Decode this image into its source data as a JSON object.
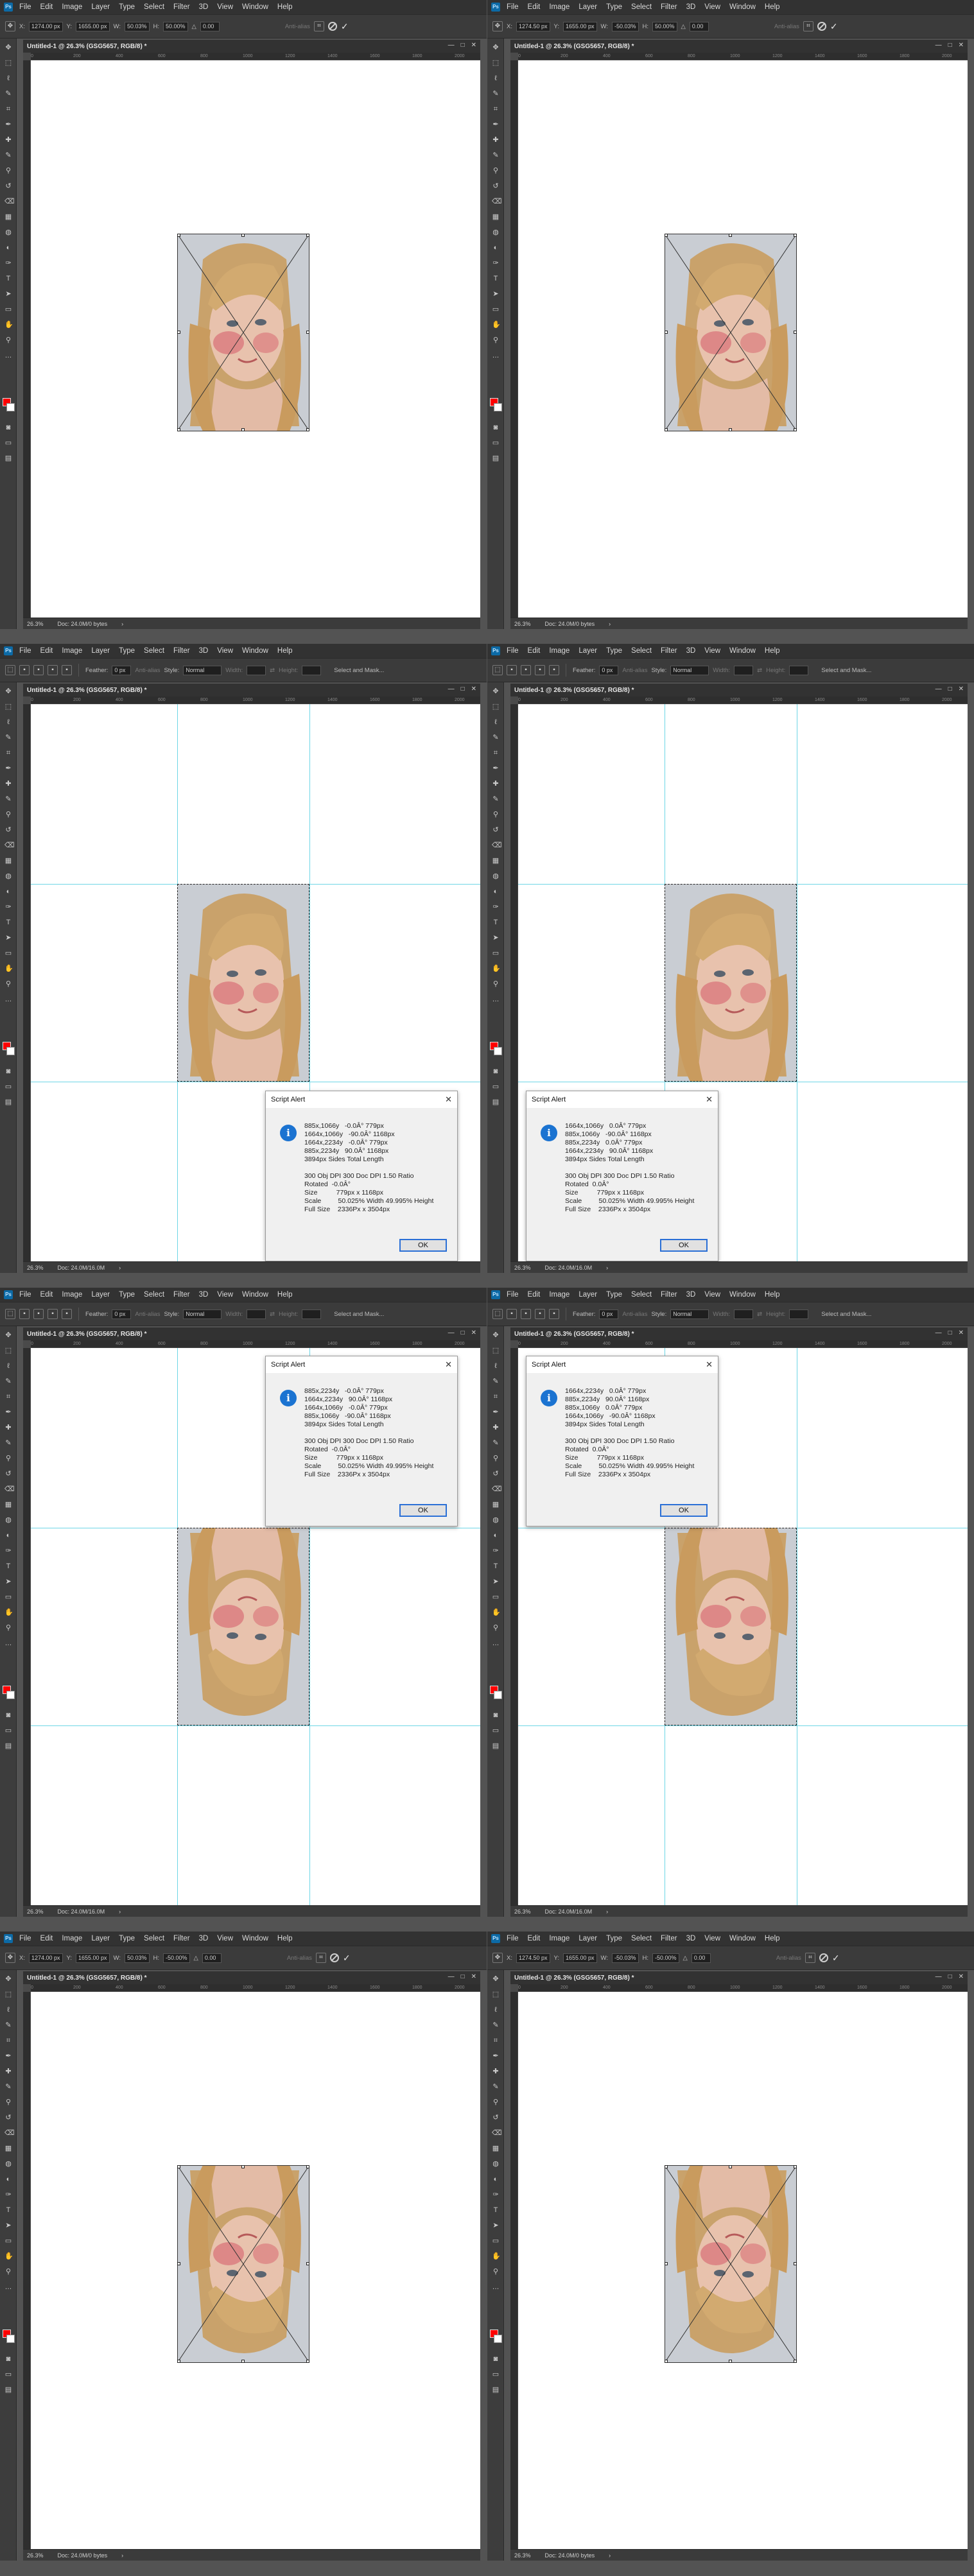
{
  "app": {
    "logo_text": "Ps",
    "menu": [
      "File",
      "Edit",
      "Image",
      "Layer",
      "Type",
      "Select",
      "Filter",
      "3D",
      "View",
      "Window",
      "Help"
    ],
    "doc_title": "Untitled-1 @ 26.3% (GSG5657, RGB/8) *",
    "zoom": "26.3%",
    "window_controls": [
      "—",
      "□",
      "✕"
    ],
    "ruler_ticks": [
      "0",
      "200",
      "400",
      "600",
      "800",
      "1000",
      "1200",
      "1400",
      "1600",
      "1800",
      "2000"
    ]
  },
  "transform_bar": {
    "x_label": "X:",
    "y_label": "Y:",
    "w_label": "W:",
    "h_label": "H:",
    "angle_label": "△",
    "interp_label": "Anti-alias"
  },
  "marquee_bar": {
    "feather_label": "Feather:",
    "feather_value": "0 px",
    "antialias_label": "Anti-alias",
    "style_label": "Style:",
    "style_value": "Normal",
    "width_label": "Width:",
    "height_label": "Height:",
    "select_mask_label": "Select and Mask..."
  },
  "panes": [
    {
      "mode": "transform",
      "opts": {
        "x": "1274.00 px",
        "y": "1655.00 px",
        "w": "50.03%",
        "h": "50.00%",
        "angle": "0.00"
      },
      "doc_status": "Doc: 24.0M/0 bytes",
      "photo_flipped": false
    },
    {
      "mode": "transform",
      "opts": {
        "x": "1274.50 px",
        "y": "1655.00 px",
        "w": "-50.03%",
        "h": "50.00%",
        "angle": "0.00"
      },
      "doc_status": "Doc: 24.0M/0 bytes",
      "photo_flipped": false
    },
    {
      "mode": "alert",
      "doc_status": "Doc: 24.0M/16.0M",
      "photo_flipped": false,
      "dialog": {
        "title": "Script Alert",
        "lines1": [
          "885x,1066y   -0.0Â° 779px",
          "1664x,1066y   -90.0Â° 1168px",
          "1664x,2234y   -0.0Â° 779px",
          "885x,2234y   90.0Â° 1168px",
          "3894px Sides Total Length"
        ],
        "lines2": [
          "300 Obj DPI 300 Doc DPI 1.50 Ratio",
          "Rotated  -0.0Â°",
          "Size          779px x 1168px",
          "Scale         50.025% Width 49.995% Height",
          "Full Size    2336Px x 3504px"
        ],
        "ok": "OK"
      }
    },
    {
      "mode": "alert",
      "doc_status": "Doc: 24.0M/16.0M",
      "photo_flipped": false,
      "dialog": {
        "title": "Script Alert",
        "lines1": [
          "1664x,1066y   0.0Â° 779px",
          "885x,1066y   -90.0Â° 1168px",
          "885x,2234y   0.0Â° 779px",
          "1664x,2234y   90.0Â° 1168px",
          "3894px Sides Total Length"
        ],
        "lines2": [
          "300 Obj DPI 300 Doc DPI 1.50 Ratio",
          "Rotated  0.0Â°",
          "Size          779px x 1168px",
          "Scale         50.025% Width 49.995% Height",
          "Full Size    2336Px x 3504px"
        ],
        "ok": "OK"
      }
    },
    {
      "mode": "alert",
      "doc_status": "Doc: 24.0M/16.0M",
      "photo_flipped": true,
      "dialog": {
        "title": "Script Alert",
        "lines1": [
          "885x,2234y   -0.0Â° 779px",
          "1664x,2234y   90.0Â° 1168px",
          "1664x,1066y   -0.0Â° 779px",
          "885x,1066y   -90.0Â° 1168px",
          "3894px Sides Total Length"
        ],
        "lines2": [
          "300 Obj DPI 300 Doc DPI 1.50 Ratio",
          "Rotated  -0.0Â°",
          "Size          779px x 1168px",
          "Scale         50.025% Width 49.995% Height",
          "Full Size    2336Px x 3504px"
        ],
        "ok": "OK"
      }
    },
    {
      "mode": "alert",
      "doc_status": "Doc: 24.0M/16.0M",
      "photo_flipped": true,
      "dialog": {
        "title": "Script Alert",
        "lines1": [
          "1664x,2234y   0.0Â° 779px",
          "885x,2234y   90.0Â° 1168px",
          "885x,1066y   0.0Â° 779px",
          "1664x,1066y   -90.0Â° 1168px",
          "3894px Sides Total Length"
        ],
        "lines2": [
          "300 Obj DPI 300 Doc DPI 1.50 Ratio",
          "Rotated  0.0Â°",
          "Size          779px x 1168px",
          "Scale         50.025% Width 49.995% Height",
          "Full Size    2336Px x 3504px"
        ],
        "ok": "OK"
      }
    },
    {
      "mode": "transform",
      "opts": {
        "x": "1274.00 px",
        "y": "1655.00 px",
        "w": "50.03%",
        "h": "-50.00%",
        "angle": "0.00"
      },
      "doc_status": "Doc: 24.0M/0 bytes",
      "photo_flipped": true
    },
    {
      "mode": "transform",
      "opts": {
        "x": "1274.50 px",
        "y": "1655.00 px",
        "w": "-50.03%",
        "h": "-50.00%",
        "angle": "0.00"
      },
      "doc_status": "Doc: 24.0M/0 bytes",
      "photo_flipped": true
    }
  ],
  "icons": {
    "tools": [
      "move-icon",
      "marquee-icon",
      "lasso-icon",
      "quick-select-icon",
      "crop-icon",
      "eyedropper-icon",
      "healing-icon",
      "brush-icon",
      "clone-stamp-icon",
      "history-brush-icon",
      "eraser-icon",
      "gradient-icon",
      "blur-icon",
      "dodge-icon",
      "pen-icon",
      "type-icon",
      "path-select-icon",
      "rectangle-icon",
      "hand-icon",
      "zoom-icon",
      "more-tools-icon"
    ]
  },
  "colors": {
    "foreground": "#ff0000",
    "background": "#ffffff",
    "guide": "#6ed6e6",
    "dialog_accent": "#1b73d1"
  }
}
